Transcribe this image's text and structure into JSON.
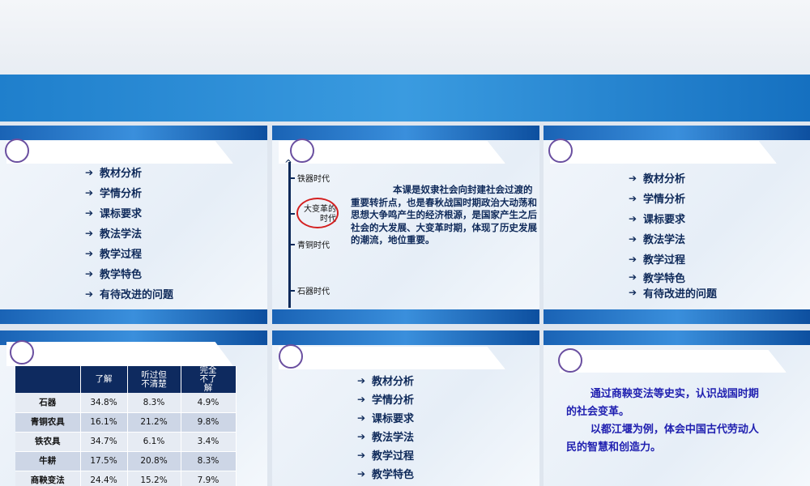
{
  "menu": [
    "教材分析",
    "学情分析",
    "课标要求",
    "教法学法",
    "教学过程",
    "教学特色",
    "有待改进的问题"
  ],
  "timeline": {
    "items": [
      "铁器时代",
      "大变革的时代",
      "青铜时代",
      "石器时代"
    ]
  },
  "paragraph": {
    "line1": "本课是奴隶社会向封建社会过渡的",
    "rest": "重要转折点，也是春秋战国时期政治大动荡和思想大争鸣产生的经济根源，是国家产生之后社会的大发展、大变革时期，体现了历史发展的潮流，地位重要。"
  },
  "table": {
    "headers": [
      "",
      "了解",
      "听过但不清楚",
      "完全不了解"
    ],
    "rows": [
      [
        "石器",
        "34.8%",
        "8.3%",
        "4.9%"
      ],
      [
        "青铜农具",
        "16.1%",
        "21.2%",
        "9.8%"
      ],
      [
        "铁农具",
        "34.7%",
        "6.1%",
        "3.4%"
      ],
      [
        "牛耕",
        "17.5%",
        "20.8%",
        "8.3%"
      ],
      [
        "商鞅变法",
        "24.4%",
        "15.2%",
        "7.9%"
      ]
    ]
  },
  "goals": [
    "通过商鞅变法等史实，认识战国时期的社会变革。",
    "以都江堰为例，体会中国古代劳动人民的智慧和创造力。"
  ],
  "arrow_glyph": "➔"
}
